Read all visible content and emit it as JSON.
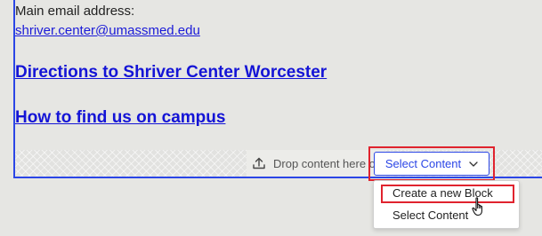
{
  "contact": {
    "email_label": "Main email address:",
    "email": "shriver.center@umassmed.edu"
  },
  "links": {
    "directions": "Directions to Shriver Center Worcester",
    "campus": "How to find us on campus"
  },
  "drop_zone": {
    "text": "Drop content here or",
    "icon": "upload-icon"
  },
  "select_button": {
    "label": "Select Content",
    "icon": "chevron-down-icon"
  },
  "dropdown": {
    "items": [
      "Create a new Block",
      "Select Content"
    ]
  },
  "colors": {
    "accent": "#2b46e6",
    "highlight": "#e0232e",
    "link": "#1a1ad8"
  }
}
